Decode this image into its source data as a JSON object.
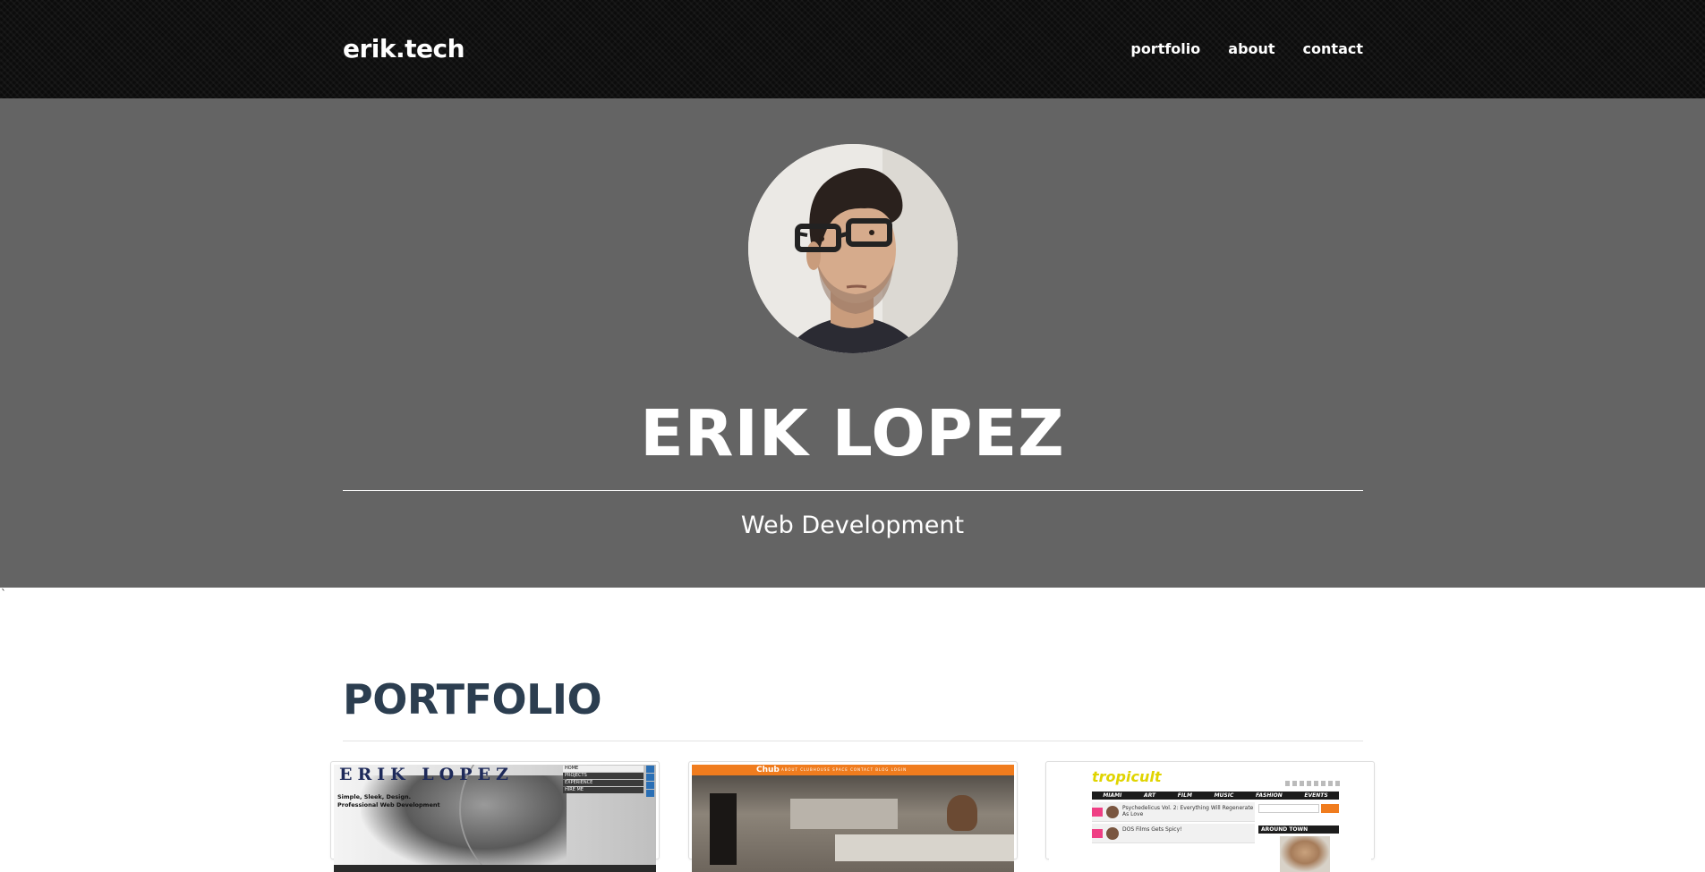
{
  "navbar": {
    "brand": "erik.tech",
    "links": [
      "portfolio",
      "about",
      "contact"
    ]
  },
  "hero": {
    "name": "ERIK LOPEZ",
    "subtitle": "Web Development",
    "avatar_alt": "profile-photo"
  },
  "stray_text": "`",
  "portfolio": {
    "title": "PORTFOLIO",
    "items": [
      {
        "title": "ERIK LOPEZ",
        "tagline_1": "Simple, Sleek, Design.",
        "tagline_2": "Professional Web Development",
        "menu": [
          "HOME",
          "PROJECTS",
          "EXPERIENCE",
          "HIRE ME"
        ]
      },
      {
        "logo": "Chub",
        "nav": "ABOUT   CLUBHOUSE   SPACE   CONTACT   BLOG   LOGIN"
      },
      {
        "logo": "tropicult",
        "nav": [
          "MIAMI",
          "ART",
          "FILM",
          "MUSIC",
          "FASHION",
          "EVENTS"
        ],
        "posts": [
          "Psychedelicus Vol. 2: Everything Will Regenerate As Love",
          "DOS Films Gets Spicy!"
        ],
        "sidebar_heading": "AROUND TOWN"
      }
    ]
  },
  "colors": {
    "navbar_bg": "#0c0c0c",
    "hero_bg": "#646464",
    "portfolio_title": "#2c3e50",
    "accent_orange": "#f07c1e"
  }
}
